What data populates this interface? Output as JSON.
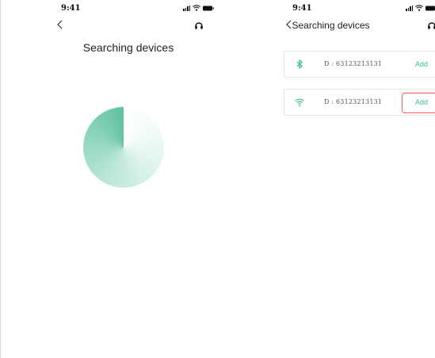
{
  "status": {
    "time": "9:41"
  },
  "screen_searching": {
    "title": "Searching  devices",
    "back_icon": "chevron-left-icon",
    "support_icon": "headset-icon",
    "accent_color": "#62c3a1"
  },
  "screen_results": {
    "title": "Searching devices",
    "devices": [
      {
        "type": "bluetooth-icon",
        "id_label": "D : 63123213131",
        "action_label": "Add",
        "highlighted": false
      },
      {
        "type": "wifi-icon",
        "id_label": "D : 63123213131",
        "action_label": "Add",
        "highlighted": true
      }
    ],
    "accent_color": "#3bbf91",
    "highlight_color": "#ef5c5c"
  }
}
